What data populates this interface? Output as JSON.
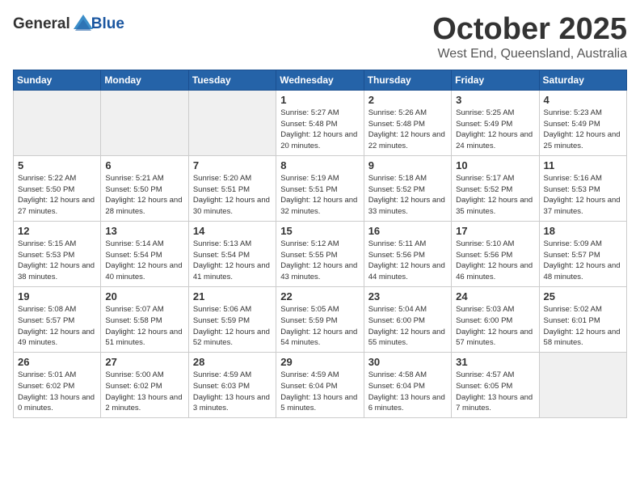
{
  "header": {
    "logo_general": "General",
    "logo_blue": "Blue",
    "month_title": "October 2025",
    "location": "West End, Queensland, Australia"
  },
  "calendar": {
    "days_of_week": [
      "Sunday",
      "Monday",
      "Tuesday",
      "Wednesday",
      "Thursday",
      "Friday",
      "Saturday"
    ],
    "weeks": [
      [
        {
          "day": "",
          "empty": true
        },
        {
          "day": "",
          "empty": true
        },
        {
          "day": "",
          "empty": true
        },
        {
          "day": "1",
          "sunrise": "Sunrise: 5:27 AM",
          "sunset": "Sunset: 5:48 PM",
          "daylight": "Daylight: 12 hours and 20 minutes."
        },
        {
          "day": "2",
          "sunrise": "Sunrise: 5:26 AM",
          "sunset": "Sunset: 5:48 PM",
          "daylight": "Daylight: 12 hours and 22 minutes."
        },
        {
          "day": "3",
          "sunrise": "Sunrise: 5:25 AM",
          "sunset": "Sunset: 5:49 PM",
          "daylight": "Daylight: 12 hours and 24 minutes."
        },
        {
          "day": "4",
          "sunrise": "Sunrise: 5:23 AM",
          "sunset": "Sunset: 5:49 PM",
          "daylight": "Daylight: 12 hours and 25 minutes."
        }
      ],
      [
        {
          "day": "5",
          "sunrise": "Sunrise: 5:22 AM",
          "sunset": "Sunset: 5:50 PM",
          "daylight": "Daylight: 12 hours and 27 minutes."
        },
        {
          "day": "6",
          "sunrise": "Sunrise: 5:21 AM",
          "sunset": "Sunset: 5:50 PM",
          "daylight": "Daylight: 12 hours and 28 minutes."
        },
        {
          "day": "7",
          "sunrise": "Sunrise: 5:20 AM",
          "sunset": "Sunset: 5:51 PM",
          "daylight": "Daylight: 12 hours and 30 minutes."
        },
        {
          "day": "8",
          "sunrise": "Sunrise: 5:19 AM",
          "sunset": "Sunset: 5:51 PM",
          "daylight": "Daylight: 12 hours and 32 minutes."
        },
        {
          "day": "9",
          "sunrise": "Sunrise: 5:18 AM",
          "sunset": "Sunset: 5:52 PM",
          "daylight": "Daylight: 12 hours and 33 minutes."
        },
        {
          "day": "10",
          "sunrise": "Sunrise: 5:17 AM",
          "sunset": "Sunset: 5:52 PM",
          "daylight": "Daylight: 12 hours and 35 minutes."
        },
        {
          "day": "11",
          "sunrise": "Sunrise: 5:16 AM",
          "sunset": "Sunset: 5:53 PM",
          "daylight": "Daylight: 12 hours and 37 minutes."
        }
      ],
      [
        {
          "day": "12",
          "sunrise": "Sunrise: 5:15 AM",
          "sunset": "Sunset: 5:53 PM",
          "daylight": "Daylight: 12 hours and 38 minutes."
        },
        {
          "day": "13",
          "sunrise": "Sunrise: 5:14 AM",
          "sunset": "Sunset: 5:54 PM",
          "daylight": "Daylight: 12 hours and 40 minutes."
        },
        {
          "day": "14",
          "sunrise": "Sunrise: 5:13 AM",
          "sunset": "Sunset: 5:54 PM",
          "daylight": "Daylight: 12 hours and 41 minutes."
        },
        {
          "day": "15",
          "sunrise": "Sunrise: 5:12 AM",
          "sunset": "Sunset: 5:55 PM",
          "daylight": "Daylight: 12 hours and 43 minutes."
        },
        {
          "day": "16",
          "sunrise": "Sunrise: 5:11 AM",
          "sunset": "Sunset: 5:56 PM",
          "daylight": "Daylight: 12 hours and 44 minutes."
        },
        {
          "day": "17",
          "sunrise": "Sunrise: 5:10 AM",
          "sunset": "Sunset: 5:56 PM",
          "daylight": "Daylight: 12 hours and 46 minutes."
        },
        {
          "day": "18",
          "sunrise": "Sunrise: 5:09 AM",
          "sunset": "Sunset: 5:57 PM",
          "daylight": "Daylight: 12 hours and 48 minutes."
        }
      ],
      [
        {
          "day": "19",
          "sunrise": "Sunrise: 5:08 AM",
          "sunset": "Sunset: 5:57 PM",
          "daylight": "Daylight: 12 hours and 49 minutes."
        },
        {
          "day": "20",
          "sunrise": "Sunrise: 5:07 AM",
          "sunset": "Sunset: 5:58 PM",
          "daylight": "Daylight: 12 hours and 51 minutes."
        },
        {
          "day": "21",
          "sunrise": "Sunrise: 5:06 AM",
          "sunset": "Sunset: 5:59 PM",
          "daylight": "Daylight: 12 hours and 52 minutes."
        },
        {
          "day": "22",
          "sunrise": "Sunrise: 5:05 AM",
          "sunset": "Sunset: 5:59 PM",
          "daylight": "Daylight: 12 hours and 54 minutes."
        },
        {
          "day": "23",
          "sunrise": "Sunrise: 5:04 AM",
          "sunset": "Sunset: 6:00 PM",
          "daylight": "Daylight: 12 hours and 55 minutes."
        },
        {
          "day": "24",
          "sunrise": "Sunrise: 5:03 AM",
          "sunset": "Sunset: 6:00 PM",
          "daylight": "Daylight: 12 hours and 57 minutes."
        },
        {
          "day": "25",
          "sunrise": "Sunrise: 5:02 AM",
          "sunset": "Sunset: 6:01 PM",
          "daylight": "Daylight: 12 hours and 58 minutes."
        }
      ],
      [
        {
          "day": "26",
          "sunrise": "Sunrise: 5:01 AM",
          "sunset": "Sunset: 6:02 PM",
          "daylight": "Daylight: 13 hours and 0 minutes."
        },
        {
          "day": "27",
          "sunrise": "Sunrise: 5:00 AM",
          "sunset": "Sunset: 6:02 PM",
          "daylight": "Daylight: 13 hours and 2 minutes."
        },
        {
          "day": "28",
          "sunrise": "Sunrise: 4:59 AM",
          "sunset": "Sunset: 6:03 PM",
          "daylight": "Daylight: 13 hours and 3 minutes."
        },
        {
          "day": "29",
          "sunrise": "Sunrise: 4:59 AM",
          "sunset": "Sunset: 6:04 PM",
          "daylight": "Daylight: 13 hours and 5 minutes."
        },
        {
          "day": "30",
          "sunrise": "Sunrise: 4:58 AM",
          "sunset": "Sunset: 6:04 PM",
          "daylight": "Daylight: 13 hours and 6 minutes."
        },
        {
          "day": "31",
          "sunrise": "Sunrise: 4:57 AM",
          "sunset": "Sunset: 6:05 PM",
          "daylight": "Daylight: 13 hours and 7 minutes."
        },
        {
          "day": "",
          "empty": true
        }
      ]
    ]
  }
}
